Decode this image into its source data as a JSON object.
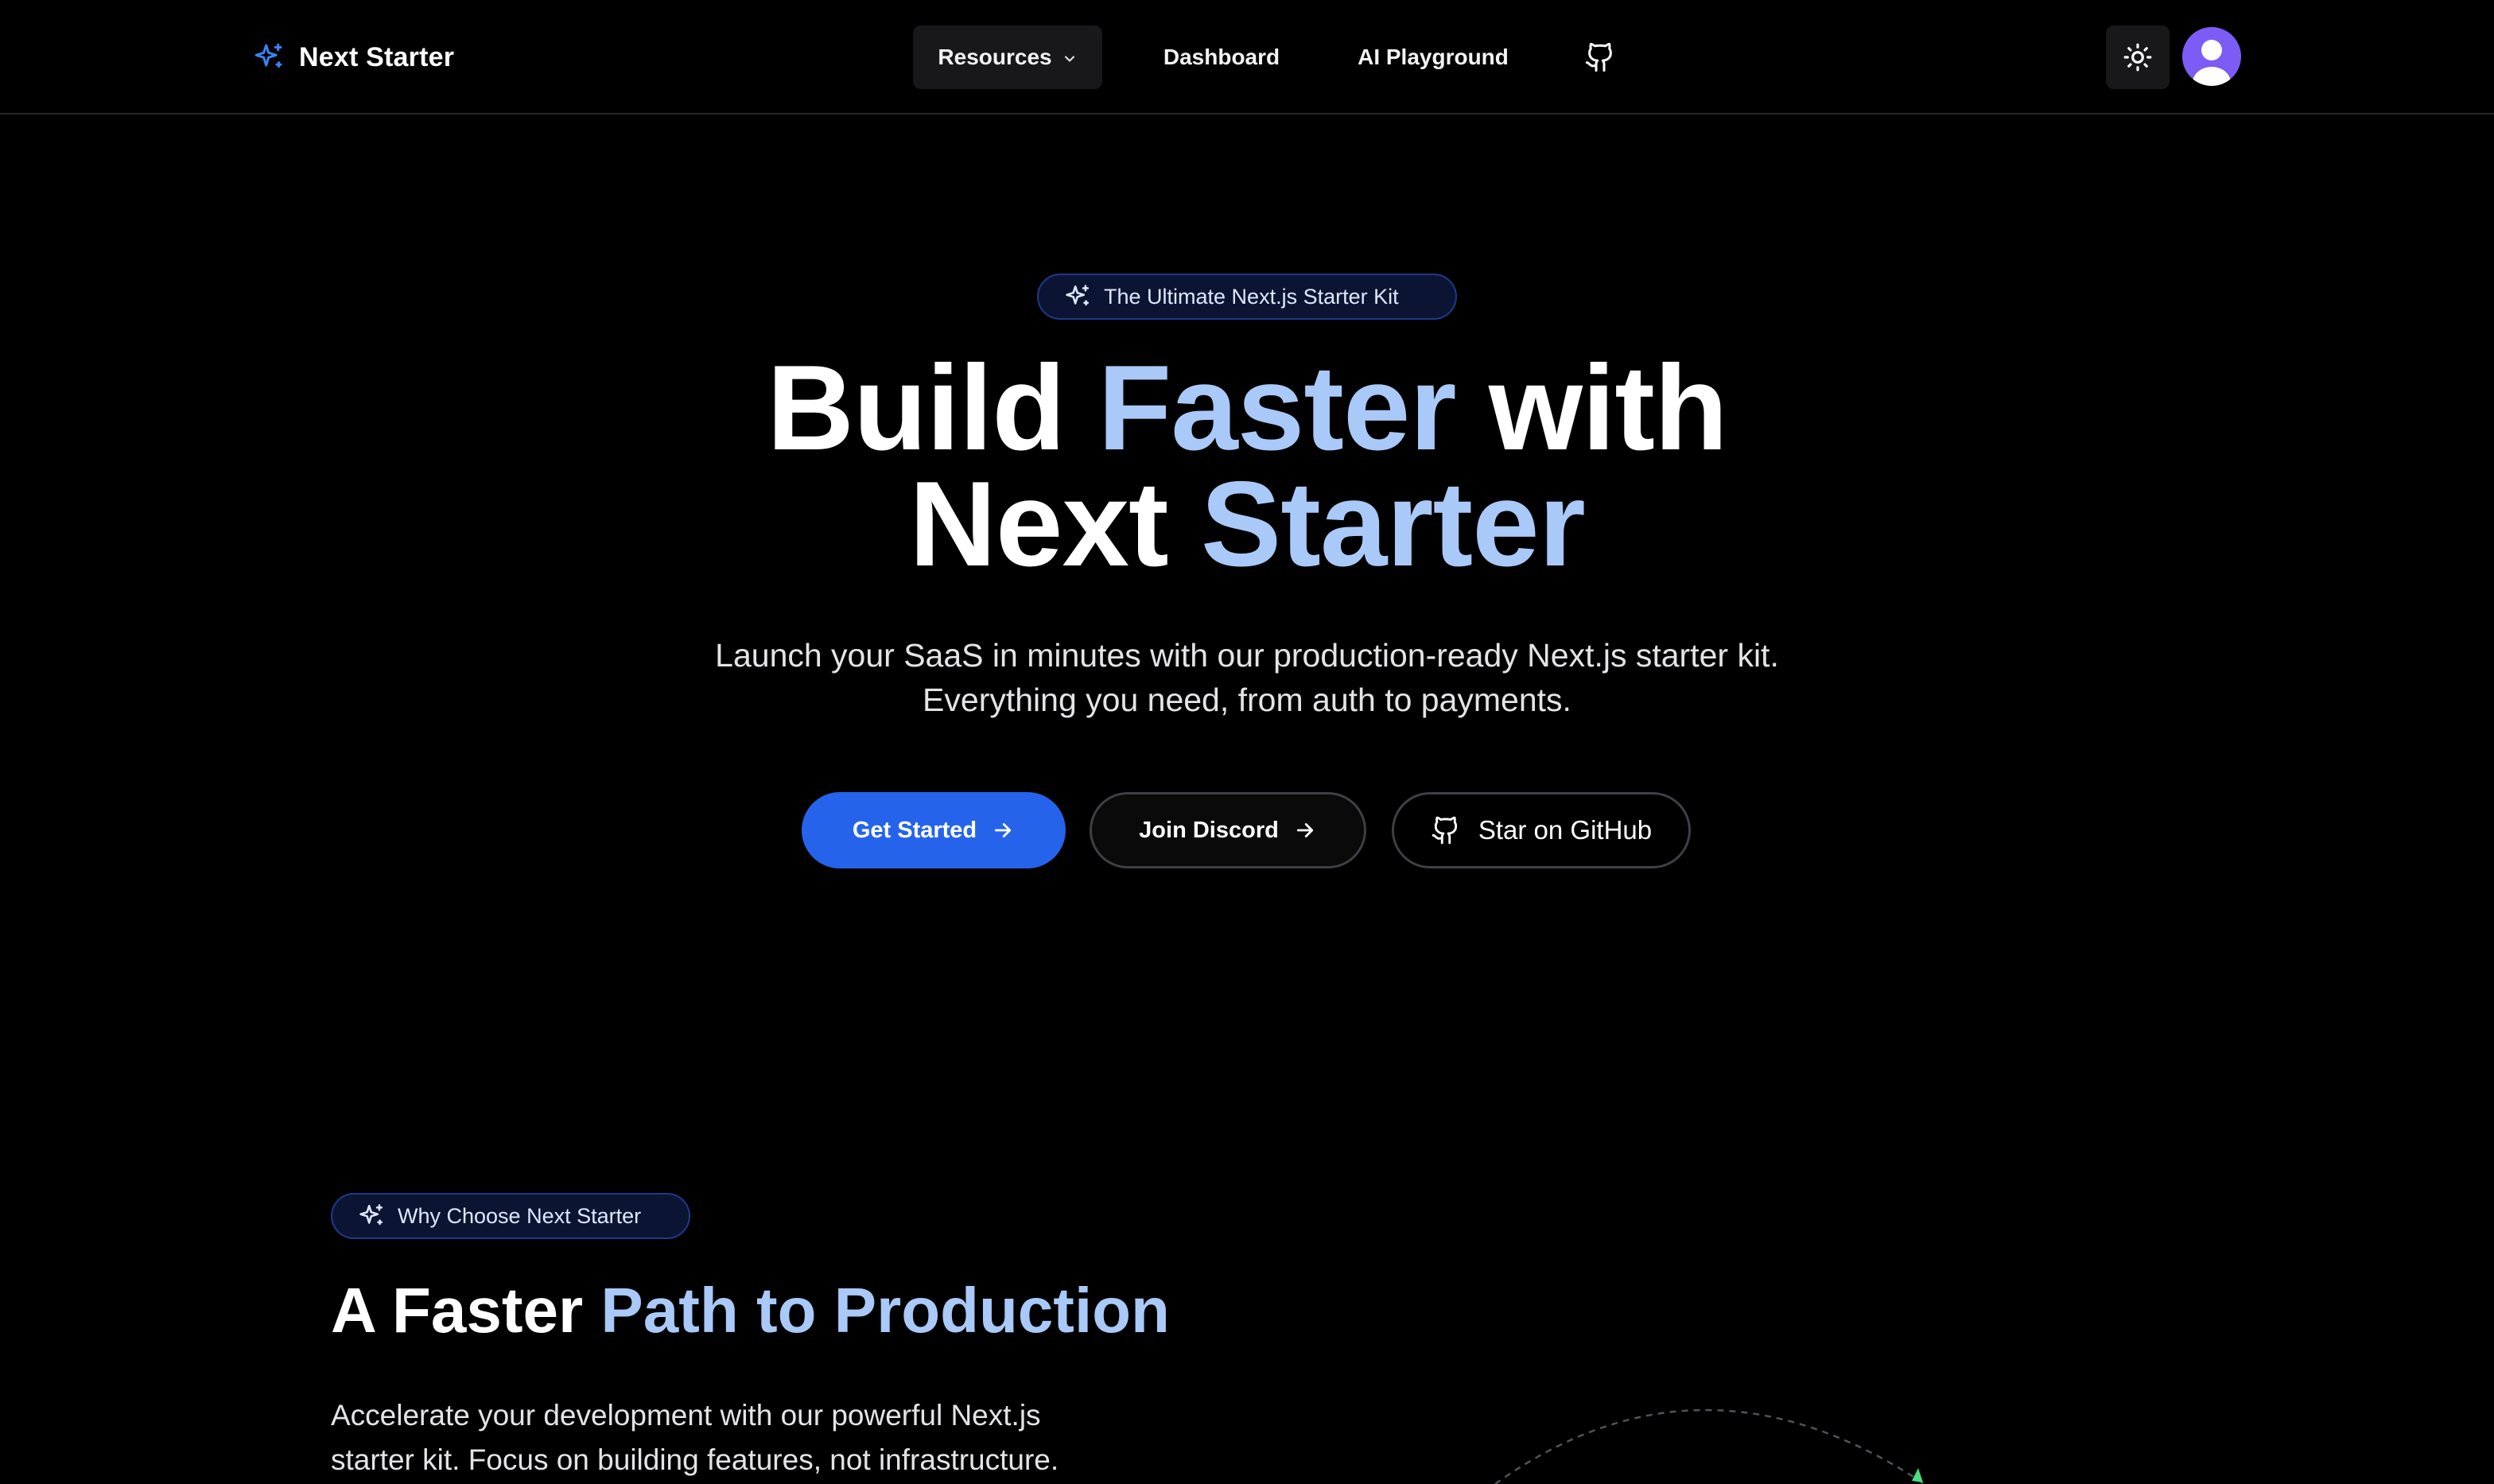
{
  "nav": {
    "brand": "Next Starter",
    "links": {
      "resources": "Resources",
      "dashboard": "Dashboard",
      "ai_playground": "AI Playground"
    },
    "github_icon": "github-icon",
    "theme_icon": "sun-icon",
    "avatar_icon": "user-icon"
  },
  "hero": {
    "badge": "The Ultimate Next.js Starter Kit",
    "title": {
      "line1_a": "Build",
      "line1_b": "Faster",
      "line1_c": "with",
      "line2_a": "Next",
      "line2_b": "Starter"
    },
    "subtitle": "Launch your SaaS in minutes with our production-ready Next.js starter kit. Everything you need, from auth to payments.",
    "buttons": {
      "get_started": "Get Started",
      "join_discord": "Join Discord",
      "star_github": "Star on GitHub"
    }
  },
  "why": {
    "badge": "Why Choose Next Starter",
    "title_a": "A Faster",
    "title_b": "Path to Production",
    "text": "Accelerate your development with our powerful Next.js starter kit. Focus on building features, not infrastructure."
  },
  "colors": {
    "background": "#000000",
    "accent_blue": "#2563eb",
    "highlight_text": "#a9c9f8",
    "badge_border": "#1e3a8a",
    "avatar": "#7c5cf5"
  }
}
